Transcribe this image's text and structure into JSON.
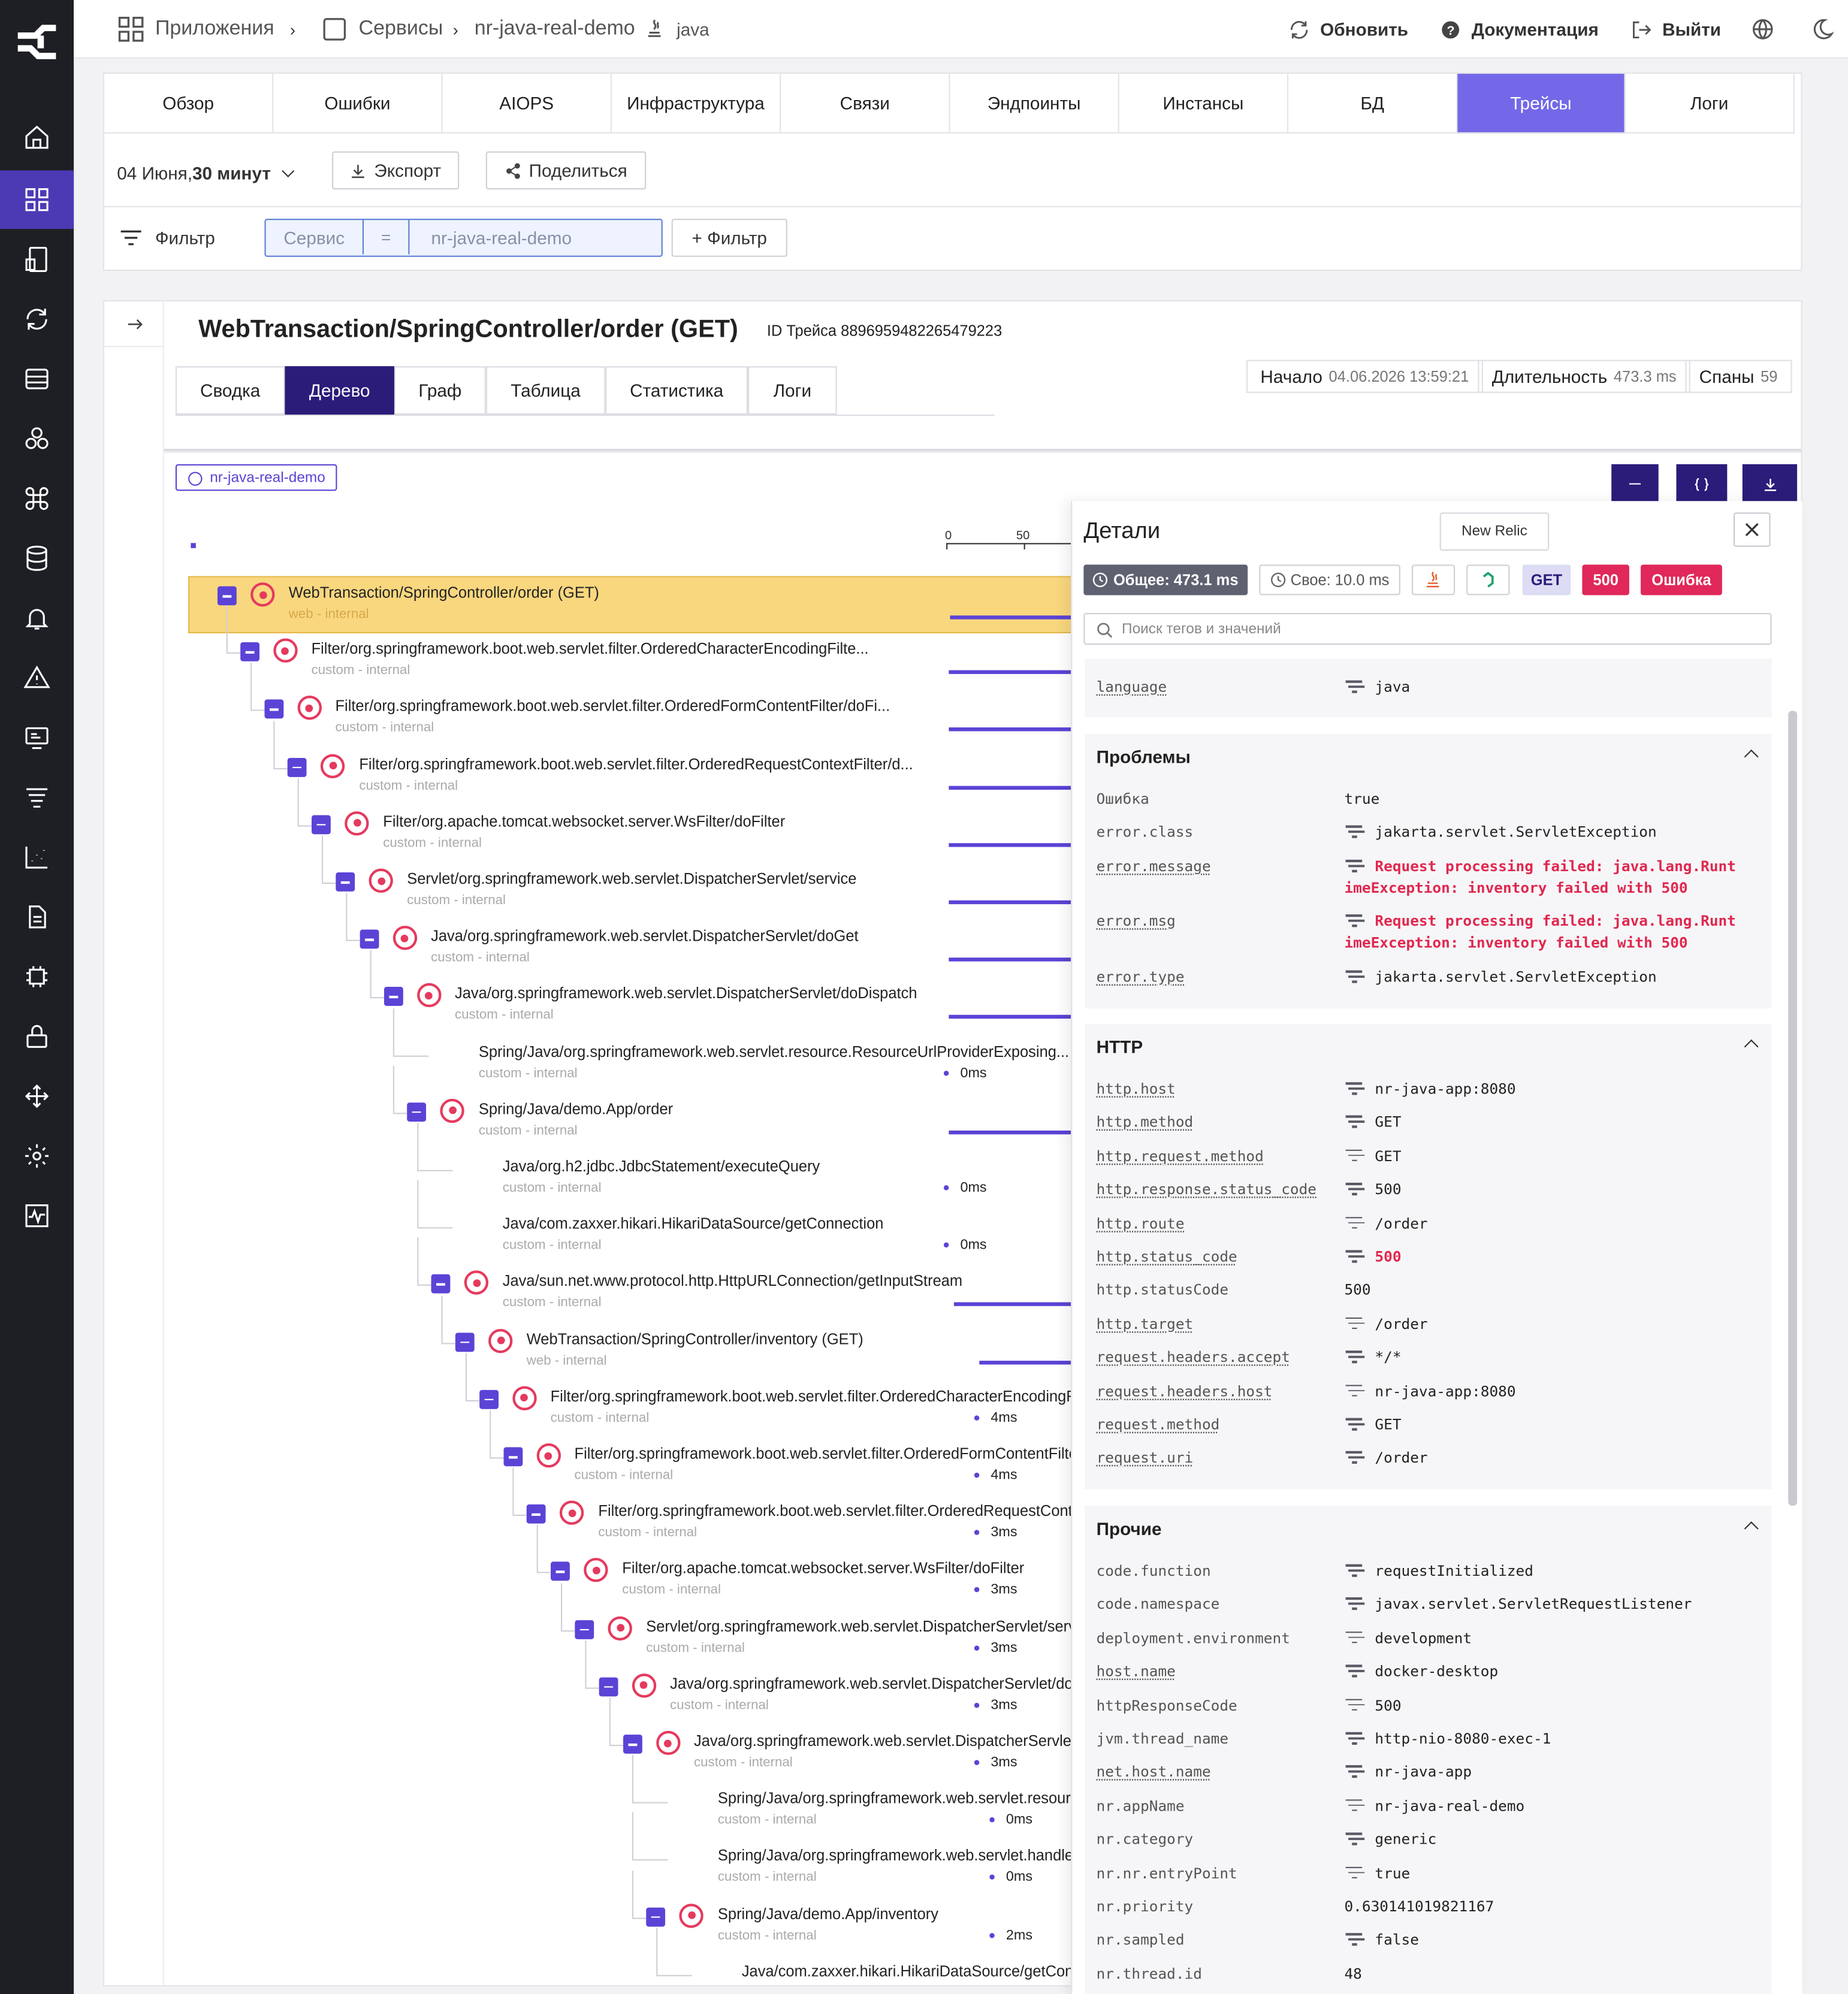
{
  "topbar": {
    "apps": "Приложения",
    "services": "Сервисы",
    "service": "nr-java-real-demo",
    "lang": "java",
    "refresh": "Обновить",
    "docs": "Документация",
    "logout": "Выйти"
  },
  "tabs": [
    "Обзор",
    "Ошибки",
    "AIOPS",
    "Инфраструктура",
    "Связи",
    "Эндпоинты",
    "Инстансы",
    "БД",
    "Трейсы",
    "Логи"
  ],
  "toolbar": {
    "date": "04 Июня, ",
    "range": "30 минут",
    "export": "Экспорт",
    "share": "Поделиться"
  },
  "filter": {
    "label": "Фильтр",
    "field": "Сервис",
    "op": "=",
    "value": "nr-java-real-demo",
    "add": "+ Фильтр"
  },
  "trace": {
    "title": "WebTransaction/SpringController/order (GET)",
    "id_label": "ID Трейса",
    "id": "8896959482265479223",
    "subtabs": [
      "Сводка",
      "Дерево",
      "Граф",
      "Таблица",
      "Статистика",
      "Логи"
    ],
    "start_label": "Начало",
    "start": "04.06.2026 13:59:21",
    "dur_label": "Длительность",
    "dur": "473.3 ms",
    "spans_label": "Спаны",
    "spans": "59",
    "service_chip": "nr-java-real-demo",
    "scale": [
      "0",
      "50"
    ]
  },
  "spans": [
    {
      "name": "WebTransaction/SpringController/order (GET)",
      "sub": "web - internal"
    },
    {
      "name": "Filter/org.springframework.boot.web.servlet.filter.OrderedCharacterEncodingFilte...",
      "sub": "custom - internal"
    },
    {
      "name": "Filter/org.springframework.boot.web.servlet.filter.OrderedFormContentFilter/doFi...",
      "sub": "custom - internal"
    },
    {
      "name": "Filter/org.springframework.boot.web.servlet.filter.OrderedRequestContextFilter/d...",
      "sub": "custom - internal"
    },
    {
      "name": "Filter/org.apache.tomcat.websocket.server.WsFilter/doFilter",
      "sub": "custom - internal"
    },
    {
      "name": "Servlet/org.springframework.web.servlet.DispatcherServlet/service",
      "sub": "custom - internal"
    },
    {
      "name": "Java/org.springframework.web.servlet.DispatcherServlet/doGet",
      "sub": "custom - internal"
    },
    {
      "name": "Java/org.springframework.web.servlet.DispatcherServlet/doDispatch",
      "sub": "custom - internal"
    },
    {
      "name": "Spring/Java/org.springframework.web.servlet.resource.ResourceUrlProviderExposing...",
      "sub": "custom - internal",
      "dur": "0ms"
    },
    {
      "name": "Spring/Java/demo.App/order",
      "sub": "custom - internal"
    },
    {
      "name": "Java/org.h2.jdbc.JdbcStatement/executeQuery",
      "sub": "custom - internal",
      "dur": "0ms"
    },
    {
      "name": "Java/com.zaxxer.hikari.HikariDataSource/getConnection",
      "sub": "custom - internal",
      "dur": "0ms"
    },
    {
      "name": "Java/sun.net.www.protocol.http.HttpURLConnection/getInputStream",
      "sub": "custom - internal"
    },
    {
      "name": "WebTransaction/SpringController/inventory (GET)",
      "sub": "web - internal"
    },
    {
      "name": "Filter/org.springframework.boot.web.servlet.filter.OrderedCharacterEncodingFil",
      "sub": "custom - internal",
      "dur": "4ms"
    },
    {
      "name": "Filter/org.springframework.boot.web.servlet.filter.OrderedFormContentFilte",
      "sub": "custom - internal",
      "dur": "4ms"
    },
    {
      "name": "Filter/org.springframework.boot.web.servlet.filter.OrderedRequestConte",
      "sub": "custom - internal",
      "dur": "3ms"
    },
    {
      "name": "Filter/org.apache.tomcat.websocket.server.WsFilter/doFilter",
      "sub": "custom - internal",
      "dur": "3ms"
    },
    {
      "name": "Servlet/org.springframework.web.servlet.DispatcherServlet/servic",
      "sub": "custom - internal",
      "dur": "3ms"
    },
    {
      "name": "Java/org.springframework.web.servlet.DispatcherServlet/doGe",
      "sub": "custom - internal",
      "dur": "3ms"
    },
    {
      "name": "Java/org.springframework.web.servlet.DispatcherServlet/d",
      "sub": "custom - internal",
      "dur": "3ms"
    },
    {
      "name": "Spring/Java/org.springframework.web.servlet.resource",
      "sub": "custom - internal",
      "dur": "0ms"
    },
    {
      "name": "Spring/Java/org.springframework.web.servlet.handler.(",
      "sub": "custom - internal",
      "dur": "0ms"
    },
    {
      "name": "Spring/Java/demo.App/inventory",
      "sub": "custom - internal",
      "dur": "2ms"
    },
    {
      "name": "Java/com.zaxxer.hikari.HikariDataSource/getConne",
      "sub": "",
      "dur": ""
    }
  ],
  "details": {
    "title": "Детали",
    "tooltip": "New Relic",
    "total": "Общее: 473.1 ms",
    "self": "Свое: 10.0 ms",
    "method": "GET",
    "code": "500",
    "error": "Ошибка",
    "search_placeholder": "Поиск тегов и значений",
    "top": {
      "key": "language",
      "val": "java"
    },
    "problems": {
      "title": "Проблемы",
      "rows": [
        {
          "k": "Ошибка",
          "v": "true"
        },
        {
          "k": "error.class",
          "v": "jakarta.servlet.ServletException"
        },
        {
          "k": "error.message",
          "v1": "Request processing failed: java.lang.Runt",
          "v2": "imeException: inventory failed with 500"
        },
        {
          "k": "error.msg",
          "v1": "Request processing failed: java.lang.Runt",
          "v2": "imeException: inventory failed with 500"
        },
        {
          "k": "error.type",
          "v": "jakarta.servlet.ServletException"
        }
      ]
    },
    "http": {
      "title": "HTTP",
      "rows": [
        {
          "k": "http.host",
          "v": "nr-java-app:8080"
        },
        {
          "k": "http.method",
          "v": "GET"
        },
        {
          "k": "http.request.method",
          "v": "GET"
        },
        {
          "k": "http.response.status_code",
          "v": "500"
        },
        {
          "k": "http.route",
          "v": "/order"
        },
        {
          "k": "http.status_code",
          "v": "500"
        },
        {
          "k": "http.statusCode",
          "v": "500"
        },
        {
          "k": "http.target",
          "v": "/order"
        },
        {
          "k": "request.headers.accept",
          "v": "*/*"
        },
        {
          "k": "request.headers.host",
          "v": "nr-java-app:8080"
        },
        {
          "k": "request.method",
          "v": "GET"
        },
        {
          "k": "request.uri",
          "v": "/order"
        }
      ]
    },
    "other": {
      "title": "Прочие",
      "rows": [
        {
          "k": "code.function",
          "v": "requestInitialized"
        },
        {
          "k": "code.namespace",
          "v": "javax.servlet.ServletRequestListener"
        },
        {
          "k": "deployment.environment",
          "v": "development"
        },
        {
          "k": "host.name",
          "v": "docker-desktop"
        },
        {
          "k": "httpResponseCode",
          "v": "500"
        },
        {
          "k": "jvm.thread_name",
          "v": "http-nio-8080-exec-1"
        },
        {
          "k": "net.host.name",
          "v": "nr-java-app"
        },
        {
          "k": "nr.appName",
          "v": "nr-java-real-demo"
        },
        {
          "k": "nr.category",
          "v": "generic"
        },
        {
          "k": "nr.nr.entryPoint",
          "v": "true"
        },
        {
          "k": "nr.priority",
          "v": "0.630141019821167"
        },
        {
          "k": "nr.sampled",
          "v": "false"
        },
        {
          "k": "nr.thread.id",
          "v": "48"
        }
      ]
    }
  },
  "colors": {
    "accent": "#7468e8",
    "dark": "#2b1c7a",
    "error": "#e53a5e",
    "sidebar": "#1e1f24"
  }
}
